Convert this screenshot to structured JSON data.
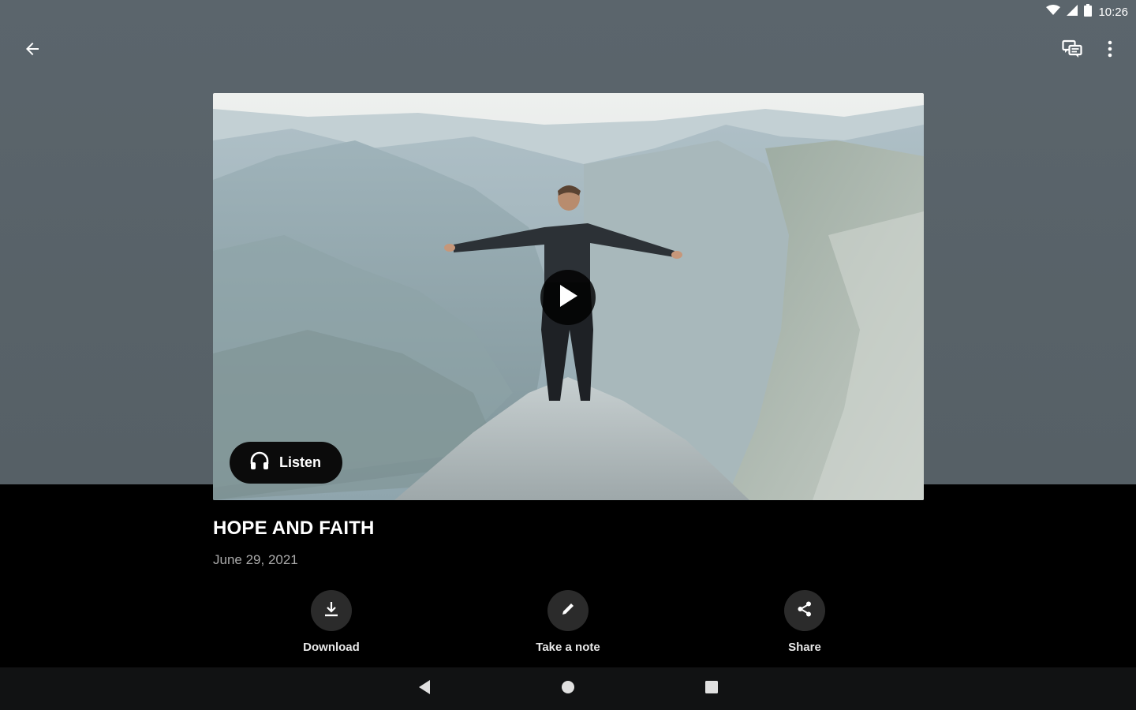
{
  "status_bar": {
    "time": "10:26"
  },
  "app_bar": {
    "back_icon": "arrow-left-icon",
    "chat_icon": "chat-bubbles-icon",
    "more_icon": "more-vertical-icon"
  },
  "media": {
    "listen_label": "Listen",
    "play_icon": "play-icon",
    "headphones_icon": "headphones-icon"
  },
  "content": {
    "title": "HOPE AND FAITH",
    "date": "June 29, 2021"
  },
  "actions": [
    {
      "label": "Download",
      "icon": "download-icon"
    },
    {
      "label": "Take a note",
      "icon": "pencil-icon"
    },
    {
      "label": "Share",
      "icon": "share-icon"
    }
  ],
  "nav": {
    "back_icon": "nav-back-icon",
    "home_icon": "nav-home-icon",
    "recents_icon": "nav-recents-icon"
  },
  "colors": {
    "header_bg": "#5b656c",
    "body_bg": "#000000",
    "action_circle": "#2b2b2b",
    "date_text": "#a9a9a9",
    "nav_bg": "#111213"
  }
}
